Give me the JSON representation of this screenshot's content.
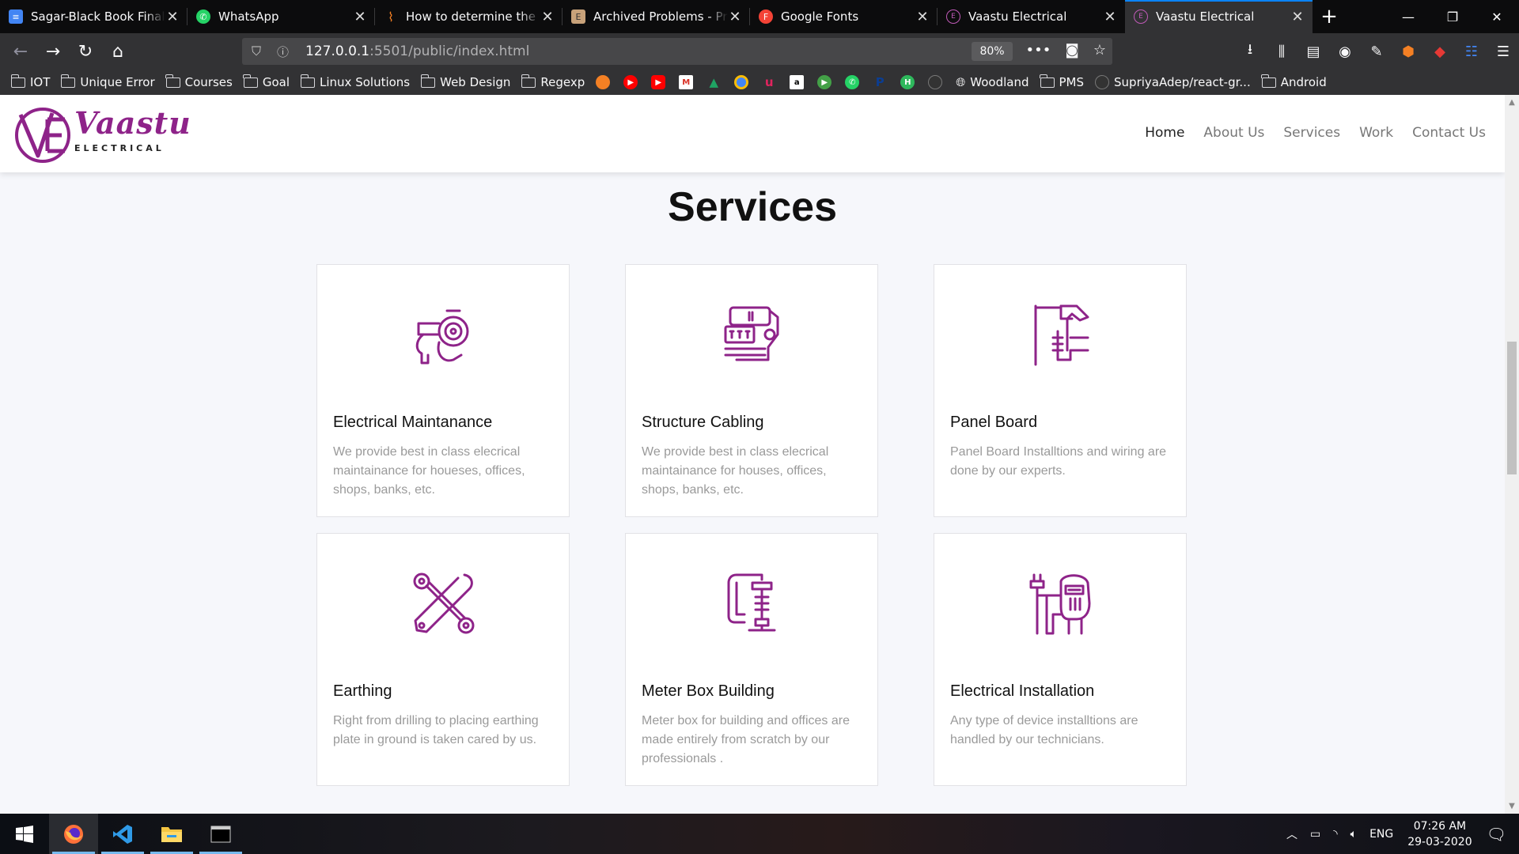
{
  "browser": {
    "tabs": [
      {
        "label": "Sagar-Black Book Final - Google Docs",
        "favicon_color": "#4285f4",
        "favicon_icon": "docs-icon"
      },
      {
        "label": "WhatsApp",
        "favicon_color": "#25d366",
        "favicon_icon": "whatsapp-icon"
      },
      {
        "label": "How to determine the current",
        "favicon_color": "#f48024",
        "favicon_icon": "stackoverflow-icon"
      },
      {
        "label": "Archived Problems - Project Euler",
        "favicon_color": "#c8a27a",
        "favicon_icon": "euler-icon"
      },
      {
        "label": "Google Fonts",
        "favicon_color": "#f44336",
        "favicon_icon": "google-fonts-icon"
      },
      {
        "label": "Vaastu Electrical",
        "favicon_color": "#8e2389",
        "favicon_icon": "vaastu-icon"
      },
      {
        "label": "Vaastu Electrical",
        "favicon_color": "#8e2389",
        "favicon_icon": "vaastu-icon"
      }
    ],
    "active_tab": 6,
    "url_host": "127.0.0.1",
    "url_path": ":5501/public/index.html",
    "zoom": "80%",
    "bookmarks": [
      {
        "label": "IOT",
        "type": "folder"
      },
      {
        "label": "Unique Error",
        "type": "folder"
      },
      {
        "label": "Courses",
        "type": "folder"
      },
      {
        "label": "Goal",
        "type": "folder"
      },
      {
        "label": "Linux Solutions",
        "type": "folder"
      },
      {
        "label": "Web Design",
        "type": "folder"
      },
      {
        "label": "Regexp",
        "type": "folder"
      }
    ],
    "bookmark_icons": [
      "#f48024",
      "#ff0000",
      "#ff0000",
      "#d93025",
      "#1fa463",
      "#4285f4",
      "#e0245e",
      "#000000",
      "#43a047",
      "#25d366",
      "#0b3d91",
      "#2eb85c",
      "#333333"
    ],
    "bookmarks_tail": [
      {
        "label": "Woodland",
        "type": "globe"
      },
      {
        "label": "PMS",
        "type": "folder"
      },
      {
        "label": "SupriyaAdep/react-gr...",
        "type": "github"
      },
      {
        "label": "Android",
        "type": "folder"
      }
    ]
  },
  "site": {
    "logo_text": "Vaastu",
    "logo_sub": "ELECTRICAL",
    "brand_color": "#8e2389",
    "nav": [
      "Home",
      "About Us",
      "Services",
      "Work",
      "Contact Us"
    ],
    "nav_active": 0,
    "section_title": "Services",
    "services": [
      {
        "title": "Electrical Maintanance",
        "desc": "We provide best in class elecrical maintainance for houeses, offices, shops, banks, etc.",
        "icon": "leaf-blower-icon"
      },
      {
        "title": "Structure Cabling",
        "desc": "We provide best in class elecrical maintainance for houses, offices, shops, banks, etc.",
        "icon": "drill-icon"
      },
      {
        "title": "Panel Board",
        "desc": "Panel Board Installtions and wiring are done by our experts.",
        "icon": "hammer-hand-icon"
      },
      {
        "title": "Earthing",
        "desc": "Right from drilling to placing earthing plate in ground is taken cared by us.",
        "icon": "wrench-cross-icon"
      },
      {
        "title": "Meter Box Building",
        "desc": "Meter box for building and offices are made entirely from scratch by our professionals .",
        "icon": "clamp-icon"
      },
      {
        "title": "Electrical Installation",
        "desc": "Any type of device installtions are handled by our technicians.",
        "icon": "welder-icon"
      }
    ]
  },
  "taskbar": {
    "language": "ENG",
    "time": "07:26 AM",
    "date": "29-03-2020"
  }
}
